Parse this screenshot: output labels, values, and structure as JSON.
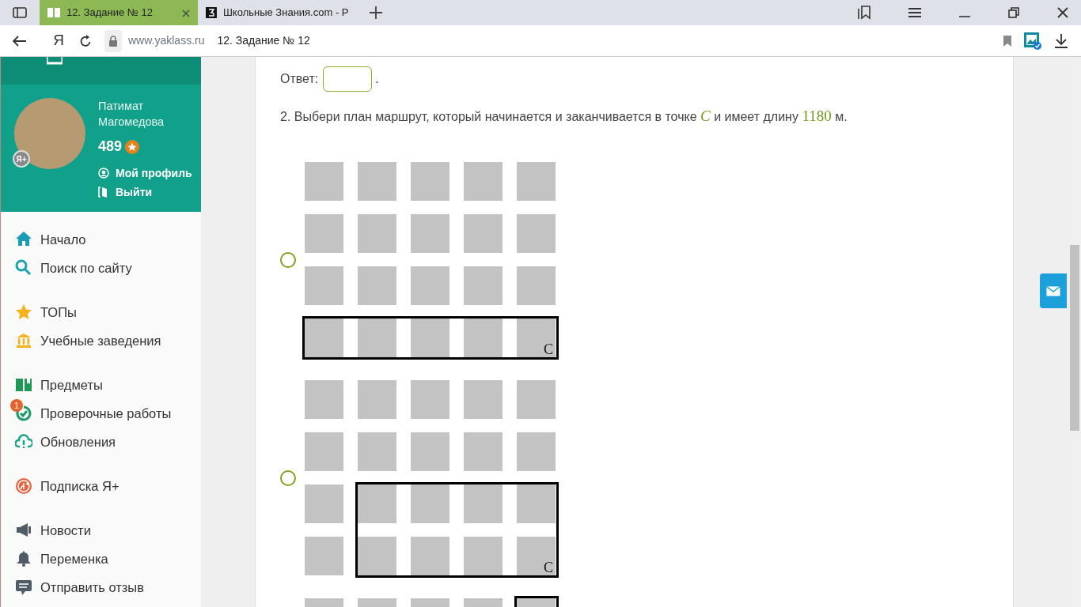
{
  "browser": {
    "tabs": [
      {
        "title": "12. Задание № 12",
        "selected": true
      },
      {
        "title": "Школьные Знания.com - Р",
        "selected": false
      }
    ],
    "address": {
      "domain": "www.yaklass.ru",
      "page_title": "12. Задание № 12"
    },
    "yandex_button": "Я"
  },
  "profile": {
    "name": "Патимат Магомедова",
    "badge": "Я+",
    "points": "489",
    "links": [
      {
        "kind": "profile",
        "label": "Мой профиль"
      },
      {
        "kind": "logout",
        "label": "Выйти"
      }
    ]
  },
  "menu_groups": [
    {
      "items": [
        {
          "kind": "home",
          "label": "Начало"
        },
        {
          "kind": "search",
          "label": "Поиск по сайту"
        }
      ]
    },
    {
      "items": [
        {
          "kind": "star",
          "label": "ТОПы"
        },
        {
          "kind": "school",
          "label": "Учебные заведения"
        }
      ]
    },
    {
      "items": [
        {
          "kind": "book",
          "label": "Предметы"
        },
        {
          "kind": "check",
          "label": "Проверочные работы",
          "badge": "1"
        },
        {
          "kind": "cloud",
          "label": "Обновления"
        }
      ]
    },
    {
      "items": [
        {
          "kind": "plus",
          "label": "Подписка Я+"
        }
      ]
    },
    {
      "items": [
        {
          "kind": "megaphone",
          "label": "Новости"
        },
        {
          "kind": "bell",
          "label": "Переменка"
        },
        {
          "kind": "comment",
          "label": "Отправить отзыв"
        }
      ]
    }
  ],
  "answer": {
    "label": "Ответ:",
    "suffix": "."
  },
  "question": {
    "parts": [
      {
        "kind": "text",
        "text": "2. Выбери план маршрут, который начинается и заканчивается в точке "
      },
      {
        "kind": "var",
        "text": "C"
      },
      {
        "kind": "text",
        "text": " и имеет длину "
      },
      {
        "kind": "num",
        "text": "1180"
      },
      {
        "kind": "text",
        "text": " м."
      }
    ]
  },
  "options": [
    {
      "kind": "bottom-row",
      "selected": false,
      "point_label": "C"
    },
    {
      "kind": "lower-right",
      "selected": false,
      "point_label": "C"
    },
    {
      "kind": "right-column"
    }
  ]
}
